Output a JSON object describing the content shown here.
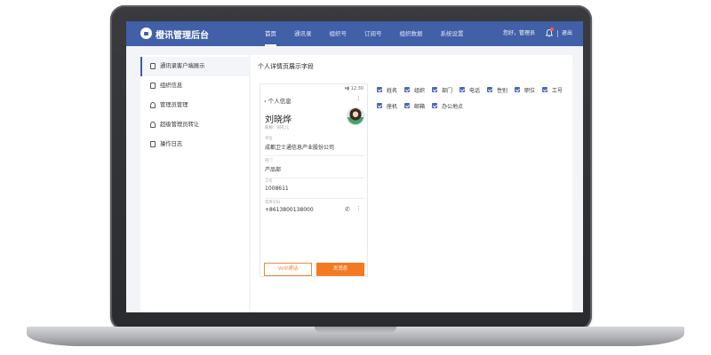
{
  "app": {
    "title": "橙讯管理后台"
  },
  "nav": {
    "items": [
      "首页",
      "通讯录",
      "组织号",
      "订阅号",
      "组织数据",
      "系统设置"
    ],
    "active_index": 0
  },
  "header": {
    "user": "您好，管理员",
    "logout": "退出"
  },
  "sidebar": {
    "items": [
      {
        "label": "通讯录客户端展示",
        "icon": "phone-icon",
        "active": true
      },
      {
        "label": "组织信息",
        "icon": "document-icon",
        "active": false
      },
      {
        "label": "管理员管理",
        "icon": "users-icon",
        "active": false
      },
      {
        "label": "超级管理员转让",
        "icon": "user-transfer-icon",
        "active": false
      },
      {
        "label": "操作日志",
        "icon": "log-icon",
        "active": false
      }
    ]
  },
  "main": {
    "title": "个人详情页展示字段"
  },
  "phone": {
    "status_time": "12:30",
    "back_label": "个人信息",
    "name": "刘晓烨",
    "sub": "昵称：刘礼儿",
    "fields": [
      {
        "label": "单位",
        "value": "成都卫士通信息产业股份公司"
      },
      {
        "label": "部门",
        "value": "产品部"
      },
      {
        "label": "工号",
        "value": "1008611"
      },
      {
        "label": "常用号码",
        "value": "+8613800138000"
      }
    ],
    "voip_button": "VoIP通话",
    "message_button": "发消息"
  },
  "fields_checkboxes": [
    {
      "label": "姓名",
      "checked": true
    },
    {
      "label": "组织",
      "checked": true
    },
    {
      "label": "部门",
      "checked": true
    },
    {
      "label": "电话",
      "checked": true
    },
    {
      "label": "性别",
      "checked": true
    },
    {
      "label": "职位",
      "checked": true
    },
    {
      "label": "工号",
      "checked": true
    },
    {
      "label": "座机",
      "checked": true
    },
    {
      "label": "邮箱",
      "checked": true
    },
    {
      "label": "办公地点",
      "checked": true
    }
  ],
  "colors": {
    "header": "#4160a8",
    "accent": "#f47a21",
    "checkbox": "#4a6ab3"
  }
}
